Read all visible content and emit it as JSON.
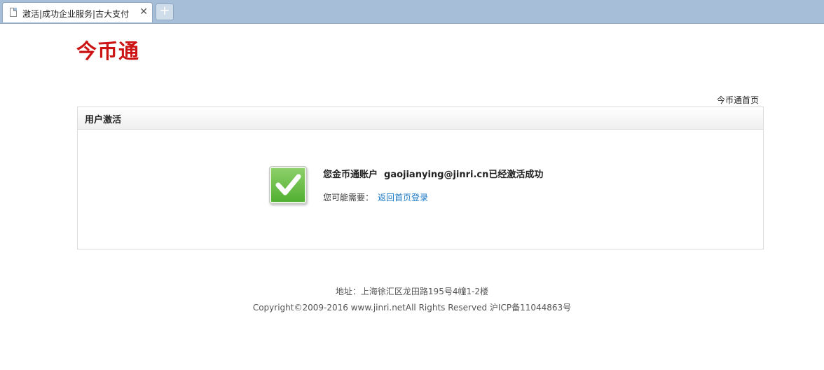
{
  "browser": {
    "tab_title": "激活|成功企业服务|古大支付",
    "close_glyph": "✕",
    "new_tab_glyph": "+"
  },
  "header": {
    "logo_text": "今币通",
    "home_link": "今币通首页"
  },
  "panel": {
    "title": "用户激活",
    "message_prefix": "您金币通账户",
    "account": "gaojianying@jinri.cn",
    "message_suffix": "已经激活成功",
    "hint_label": "您可能需要：",
    "hint_link": "返回首页登录"
  },
  "footer": {
    "address": "地址：上海徐汇区龙田路195号4幢1-2楼",
    "copyright": "Copyright©2009-2016 www.jinri.netAll Rights Reserved 沪ICP备11044863号"
  },
  "colors": {
    "brand": "#cc1414",
    "link": "#1a7ac6",
    "success_green": "#4fae2f"
  },
  "icons": {
    "tab": "document-icon",
    "status": "checkmark-icon"
  }
}
